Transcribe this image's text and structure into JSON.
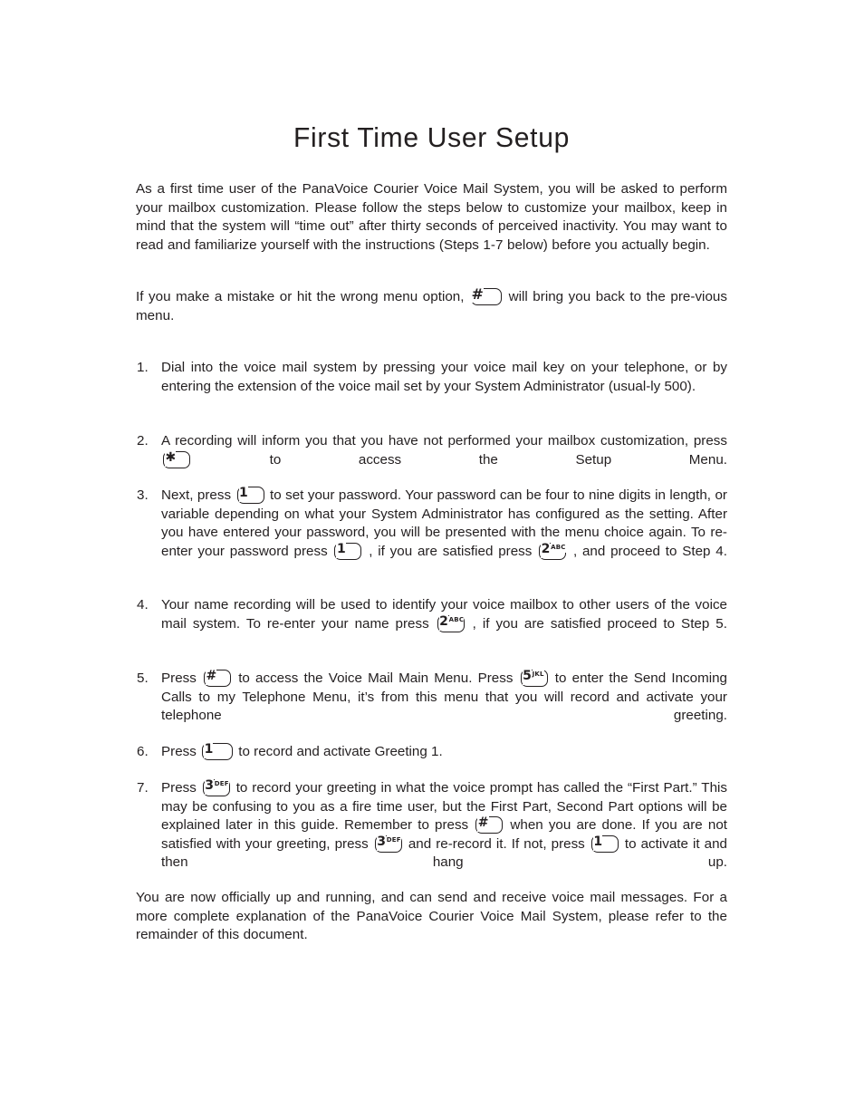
{
  "document": {
    "title": "First Time User Setup",
    "text_color": "#231f20",
    "background_color": "#ffffff"
  },
  "intro": {
    "paragraph_1": "As a first time user of the PanaVoice Courier Voice Mail System, you will  be asked to perform your mailbox customization.  Please follow the steps below to customize your mailbox, keep in mind that the system will “time out” after thirty seconds of perceived inactivity.  You may want to read and familiarize yourself with the instructions (Steps 1-7 below) before you actually begin.",
    "paragraph_2_before_key": "If you make a mistake or hit the wrong menu option,",
    "paragraph_2_after_key": "will bring you back to the pre-vious menu."
  },
  "keys": {
    "pound": {
      "glyph": "#",
      "letters": "",
      "name": "pound-key"
    },
    "star": {
      "glyph": "✱",
      "letters": "",
      "name": "star-key"
    },
    "one": {
      "glyph": "1",
      "letters": "",
      "name": "one-key"
    },
    "two": {
      "glyph": "2",
      "letters": "ABC",
      "name": "two-key"
    },
    "three": {
      "glyph": "3",
      "letters": "DEF",
      "name": "three-key"
    },
    "five": {
      "glyph": "5",
      "letters": "JKL",
      "name": "five-key"
    }
  },
  "steps": [
    {
      "number": "1.",
      "segments": [
        {
          "type": "text",
          "value": "Dial into the voice mail system by pressing your voice mail key on your telephone, or by entering the extension of the voice mail set by your System Administrator (usual-ly 500)."
        }
      ]
    },
    {
      "number": "2.",
      "segments": [
        {
          "type": "text",
          "value": "A recording will inform you that you have not performed your mailbox customization, press"
        },
        {
          "type": "key",
          "key": "star"
        },
        {
          "type": "text",
          "value": "to access the Setup Menu."
        }
      ]
    },
    {
      "number": "3.",
      "segments": [
        {
          "type": "text",
          "value": "Next, press"
        },
        {
          "type": "key",
          "key": "one"
        },
        {
          "type": "text",
          "value": "to set your password.  Your password can be four to nine digits in length, or variable depending on what your System Administrator has configured as the setting.  After you have entered your password, you will be presented with the menu choice again.  To re-enter your password press"
        },
        {
          "type": "key",
          "key": "one"
        },
        {
          "type": "text",
          "value": ", if you are satisfied press"
        },
        {
          "type": "key",
          "key": "two"
        },
        {
          "type": "text",
          "value": ", and proceed to Step 4."
        }
      ]
    },
    {
      "number": "4.",
      "segments": [
        {
          "type": "text",
          "value": "Your name recording will be used to identify your voice mailbox to other users of the voice mail system.  To re-enter your name press"
        },
        {
          "type": "key",
          "key": "two"
        },
        {
          "type": "text",
          "value": ", if you are satisfied proceed to Step 5."
        }
      ]
    },
    {
      "number": "5.",
      "segments": [
        {
          "type": "text",
          "value": "Press"
        },
        {
          "type": "key",
          "key": "pound"
        },
        {
          "type": "text",
          "value": "to access the Voice Mail Main Menu.  Press"
        },
        {
          "type": "key",
          "key": "five"
        },
        {
          "type": "text",
          "value": "to enter the Send Incoming Calls to my Telephone Menu, it’s from this menu that you will record and activate your telephone greeting."
        }
      ]
    },
    {
      "number": "6.",
      "segments": [
        {
          "type": "text",
          "value": "Press"
        },
        {
          "type": "key",
          "key": "one"
        },
        {
          "type": "text",
          "value": "to record and activate Greeting 1."
        }
      ]
    },
    {
      "number": "7.",
      "segments": [
        {
          "type": "text",
          "value": "Press"
        },
        {
          "type": "key",
          "key": "three"
        },
        {
          "type": "text",
          "value": "to record your greeting in what the voice prompt has called the “First Part.”  This may be confusing to you as a fire time user, but the First Part, Second Part options will be explained later in this guide.  Remember to press"
        },
        {
          "type": "key",
          "key": "pound"
        },
        {
          "type": "text",
          "value": "when you are done.  If you are not satisfied with your greeting, press"
        },
        {
          "type": "key",
          "key": "three"
        },
        {
          "type": "text",
          "value": "and re-record it.  If not, press"
        },
        {
          "type": "key",
          "key": "one"
        },
        {
          "type": "text",
          "value": "to activate it and then hang up."
        }
      ]
    }
  ],
  "closing": {
    "paragraph": "You are now officially up and running, and can send and receive voice mail messages.  For a more complete explanation of the PanaVoice Courier Voice Mail System, please refer to the remainder of this document."
  }
}
